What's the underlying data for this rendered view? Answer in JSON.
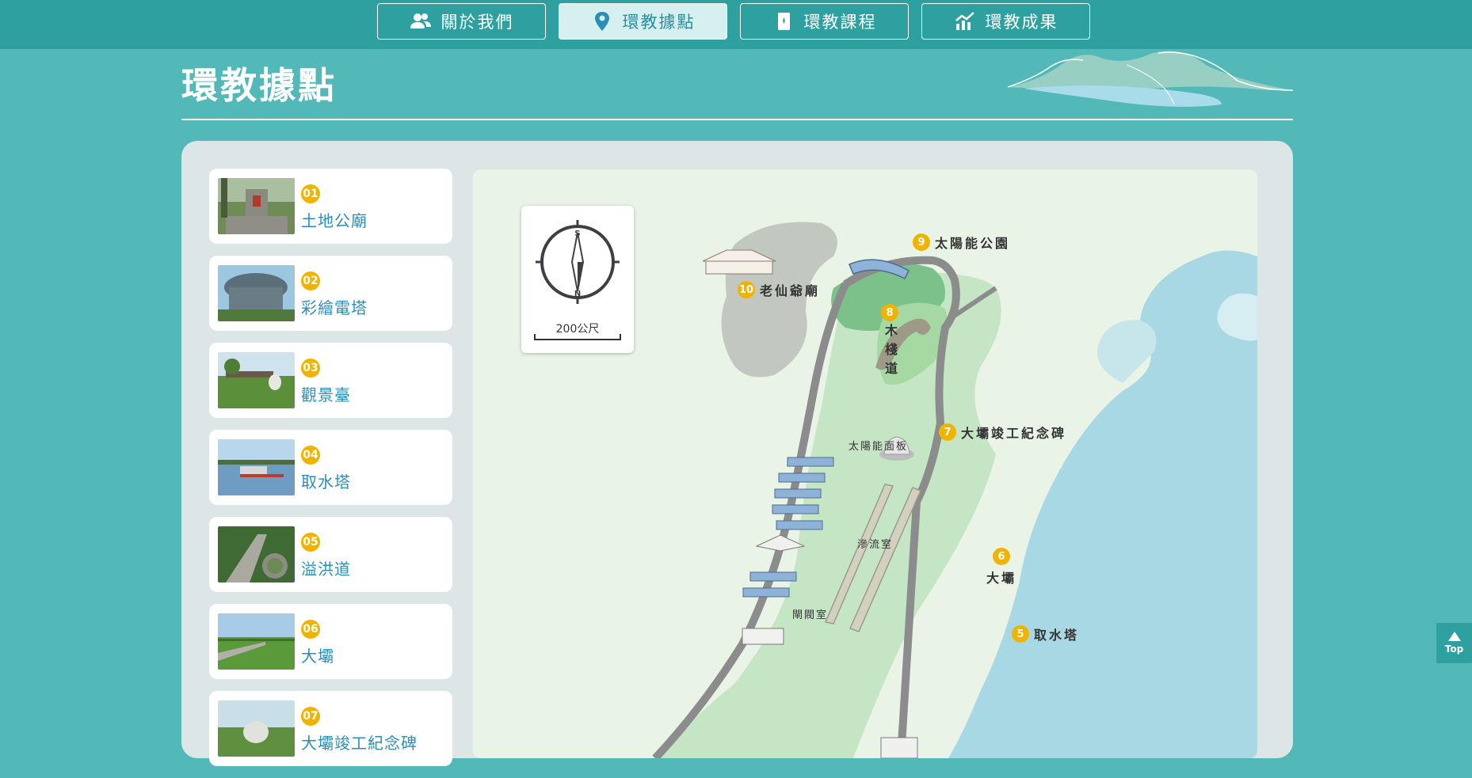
{
  "nav": {
    "items": [
      {
        "label": "關於我們",
        "icon": "users-icon",
        "active": false
      },
      {
        "label": "環教據點",
        "icon": "location-pin-icon",
        "active": true
      },
      {
        "label": "環教課程",
        "icon": "book-icon",
        "active": false
      },
      {
        "label": "環教成果",
        "icon": "chart-icon",
        "active": false
      }
    ]
  },
  "page": {
    "title": "環教據點"
  },
  "spots": [
    {
      "num": "01",
      "name": "土地公廟"
    },
    {
      "num": "02",
      "name": "彩繪電塔"
    },
    {
      "num": "03",
      "name": "觀景臺"
    },
    {
      "num": "04",
      "name": "取水塔"
    },
    {
      "num": "05",
      "name": "溢洪道"
    },
    {
      "num": "06",
      "name": "大壩"
    },
    {
      "num": "07",
      "name": "大壩竣工紀念碑"
    }
  ],
  "map": {
    "compass": {
      "north": "N",
      "south": "S",
      "scale": "200公尺"
    },
    "markers": [
      {
        "num": "9",
        "name": "太陽能公園"
      },
      {
        "num": "10",
        "name": "老仙爺廟"
      },
      {
        "num": "8",
        "name": "木棧道"
      },
      {
        "num": "7",
        "name": "大壩竣工紀念碑"
      },
      {
        "num": "6",
        "name": "大壩"
      },
      {
        "num": "5",
        "name": "取水塔"
      }
    ],
    "notes": {
      "solar_panels": "太陽能面板",
      "seepage_room": "滲流室",
      "gate_room": "閘閥室"
    }
  },
  "top_button": {
    "label": "Top"
  },
  "colors": {
    "page_bg": "#52b8b8",
    "topbar": "#2ea0a0",
    "accent_number": "#f0b400",
    "spot_text": "#2a8eb8",
    "panel_bg": "#dde6e6",
    "map_water": "#a8d8e4",
    "map_land": "#c4e6c4"
  }
}
